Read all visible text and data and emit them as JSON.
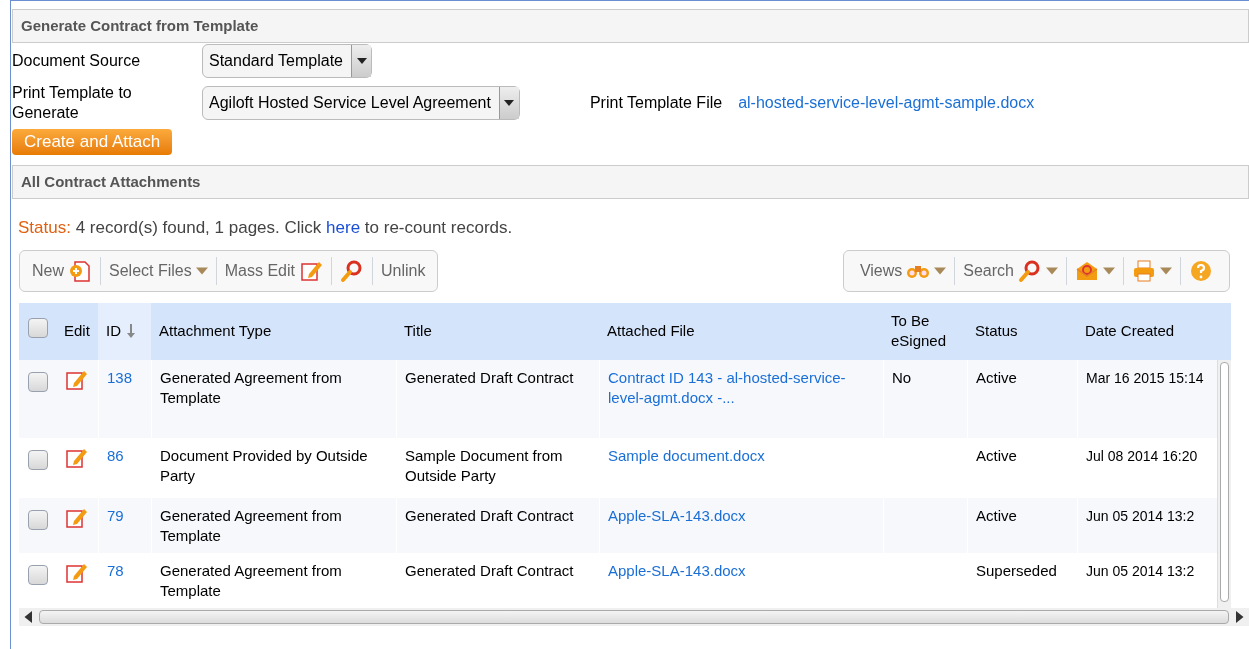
{
  "generate_section": {
    "title": "Generate Contract from Template"
  },
  "fields": [
    {
      "label": "Document Source",
      "value": "Standard Template"
    },
    {
      "label": "Print Template to Generate",
      "value": "Agiloft Hosted Service Level Agreement",
      "file_label": "Print Template File",
      "file_link": "al-hosted-service-level-agmt-sample.docx"
    }
  ],
  "create_button": "Create and Attach",
  "attachments_section": {
    "title": "All Contract Attachments"
  },
  "status": {
    "label": "Status:",
    "before": "4 record(s) found, 1 pages. Click",
    "link": "here",
    "after": "to re-count records."
  },
  "left_toolbar": [
    {
      "kind": "new",
      "label": "New",
      "dropdown": false
    },
    {
      "kind": "plain",
      "label": "Select Files",
      "dropdown": true
    },
    {
      "kind": "edit",
      "label": "Mass Edit",
      "dropdown": false
    },
    {
      "kind": "search",
      "dropdown": false
    },
    {
      "kind": "plain",
      "label": "Unlink",
      "dropdown": false
    }
  ],
  "right_toolbar": [
    {
      "kind": "binoculars",
      "label": "Views",
      "dropdown": true
    },
    {
      "kind": "search",
      "label": "Search",
      "dropdown": true
    },
    {
      "kind": "mail",
      "dropdown": true
    },
    {
      "kind": "print",
      "dropdown": true
    },
    {
      "kind": "help",
      "dropdown": false
    }
  ],
  "table": {
    "all_checked": false,
    "columns": [
      {
        "label": "Edit",
        "sorted": false
      },
      {
        "label": "ID",
        "sorted": true
      },
      {
        "label": "Attachment Type",
        "sorted": false
      },
      {
        "label": "Title",
        "sorted": false
      },
      {
        "label": "Attached File",
        "sorted": false
      },
      {
        "label": "To Be eSigned",
        "sorted": false
      },
      {
        "label": "Status",
        "sorted": false
      },
      {
        "label": "Date Created",
        "sorted": false
      }
    ],
    "rows": [
      {
        "checked": false,
        "id": "138",
        "type": "Generated Agreement from Template",
        "title": "Generated Draft Contract",
        "file": "Contract ID 143 - al-hosted-service-level-agmt.docx -...",
        "esigned": "No",
        "status": "Active",
        "date": "Mar 16 2015 15:14"
      },
      {
        "checked": false,
        "id": "86",
        "type": "Document Provided by Outside Party",
        "title": "Sample Document from Outside Party",
        "file": "Sample document.docx",
        "status": "Active",
        "date": "Jul 08 2014 16:20"
      },
      {
        "checked": false,
        "id": "79",
        "type": "Generated Agreement from Template",
        "title": "Generated Draft Contract",
        "file": "Apple-SLA-143.docx",
        "status": "Active",
        "date": "Jun 05 2014 13:2"
      },
      {
        "checked": false,
        "id": "78",
        "type": "Generated Agreement from Template",
        "title": "Generated Draft Contract",
        "file": "Apple-SLA-143.docx",
        "status": "Superseded",
        "date": "Jun 05 2014 13:2"
      }
    ]
  }
}
